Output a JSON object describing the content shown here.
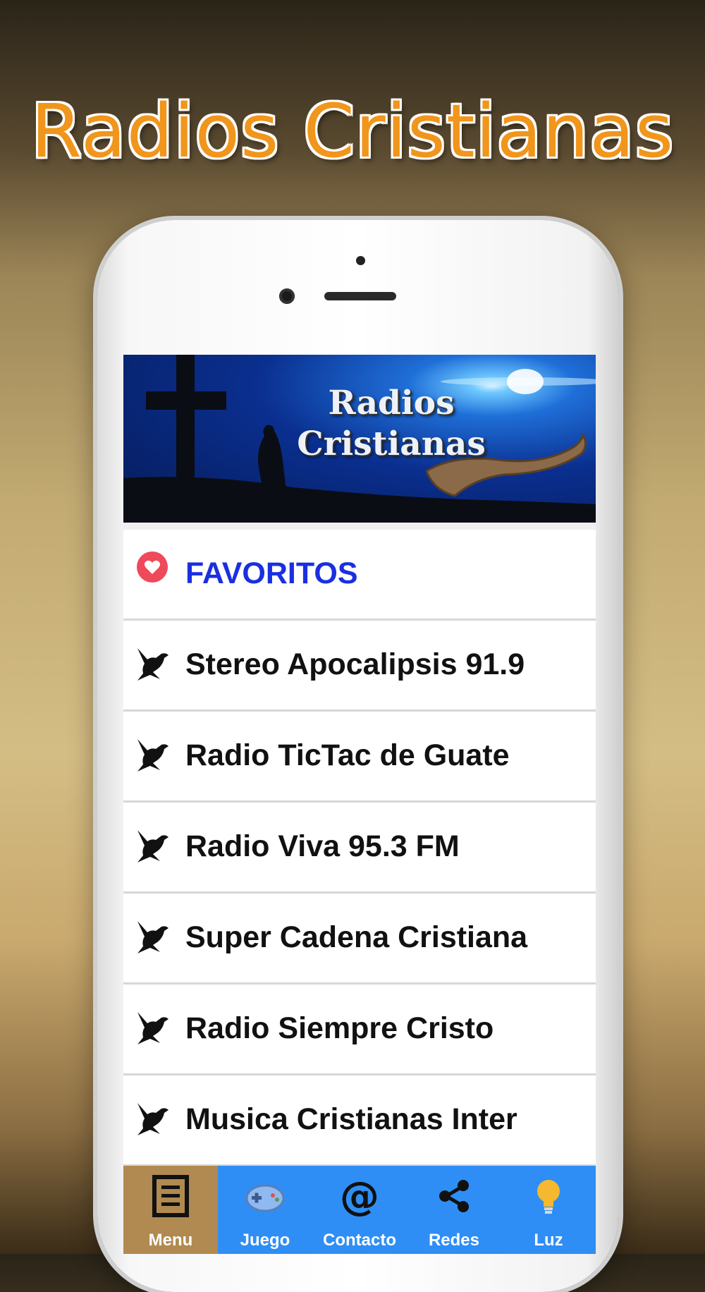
{
  "promo": {
    "title": "Radios Cristianas"
  },
  "banner": {
    "title_line1": "Radios",
    "title_line2": "Cristianas"
  },
  "favorites": {
    "label": "FAVORITOS",
    "icon": "heart-icon",
    "color": "#1b2fe0"
  },
  "stations": [
    {
      "label": "Stereo Apocalipsis 91.9",
      "icon": "dove-icon"
    },
    {
      "label": "Radio TicTac de Guate",
      "icon": "dove-icon"
    },
    {
      "label": "Radio Viva 95.3 FM",
      "icon": "dove-icon"
    },
    {
      "label": "Super Cadena Cristiana",
      "icon": "dove-icon"
    },
    {
      "label": "Radio Siempre Cristo",
      "icon": "dove-icon"
    },
    {
      "label": "Musica Cristianas Inter",
      "icon": "dove-icon"
    }
  ],
  "tabbar": {
    "background": "#2e8ef5",
    "active_background": "#b08a50",
    "tabs": [
      {
        "label": "Menu",
        "icon": "menu-list-icon",
        "active": true
      },
      {
        "label": "Juego",
        "icon": "gamepad-icon",
        "active": false
      },
      {
        "label": "Contacto",
        "icon": "at-sign-icon",
        "active": false
      },
      {
        "label": "Redes",
        "icon": "share-icon",
        "active": false
      },
      {
        "label": "Luz",
        "icon": "lightbulb-icon",
        "active": false
      }
    ]
  },
  "colors": {
    "accent_title": "#f0961c"
  }
}
